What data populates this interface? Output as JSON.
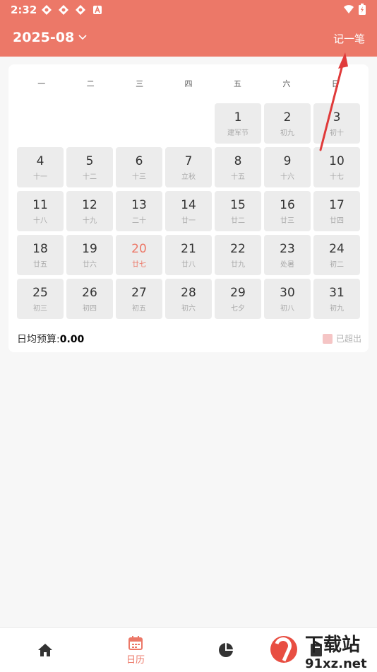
{
  "status": {
    "time": "2:32"
  },
  "header": {
    "month": "2025-08",
    "record_label": "记一笔"
  },
  "weekdays": [
    "一",
    "二",
    "三",
    "四",
    "五",
    "六",
    "日"
  ],
  "calendar": {
    "leading_empty": 4,
    "today": 20,
    "days": [
      {
        "d": "1",
        "l": "建军节"
      },
      {
        "d": "2",
        "l": "初九"
      },
      {
        "d": "3",
        "l": "初十"
      },
      {
        "d": "4",
        "l": "十一"
      },
      {
        "d": "5",
        "l": "十二"
      },
      {
        "d": "6",
        "l": "十三"
      },
      {
        "d": "7",
        "l": "立秋"
      },
      {
        "d": "8",
        "l": "十五"
      },
      {
        "d": "9",
        "l": "十六"
      },
      {
        "d": "10",
        "l": "十七"
      },
      {
        "d": "11",
        "l": "十八"
      },
      {
        "d": "12",
        "l": "十九"
      },
      {
        "d": "13",
        "l": "二十"
      },
      {
        "d": "14",
        "l": "廿一"
      },
      {
        "d": "15",
        "l": "廿二"
      },
      {
        "d": "16",
        "l": "廿三"
      },
      {
        "d": "17",
        "l": "廿四"
      },
      {
        "d": "18",
        "l": "廿五"
      },
      {
        "d": "19",
        "l": "廿六"
      },
      {
        "d": "20",
        "l": "廿七"
      },
      {
        "d": "21",
        "l": "廿八"
      },
      {
        "d": "22",
        "l": "廿九"
      },
      {
        "d": "23",
        "l": "处暑"
      },
      {
        "d": "24",
        "l": "初二"
      },
      {
        "d": "25",
        "l": "初三"
      },
      {
        "d": "26",
        "l": "初四"
      },
      {
        "d": "27",
        "l": "初五"
      },
      {
        "d": "28",
        "l": "初六"
      },
      {
        "d": "29",
        "l": "七夕"
      },
      {
        "d": "30",
        "l": "初八"
      },
      {
        "d": "31",
        "l": "初九"
      }
    ]
  },
  "budget": {
    "label": "日均预算:",
    "value": "0.00"
  },
  "legend": {
    "label": "已超出"
  },
  "tabs": {
    "calendar_label": "日历"
  },
  "watermark": {
    "brand": "下载站",
    "domain": "91xz.net"
  },
  "colors": {
    "accent": "#ec7868",
    "cell_bg": "#ececec",
    "exceeded": "#f5c5c5"
  }
}
